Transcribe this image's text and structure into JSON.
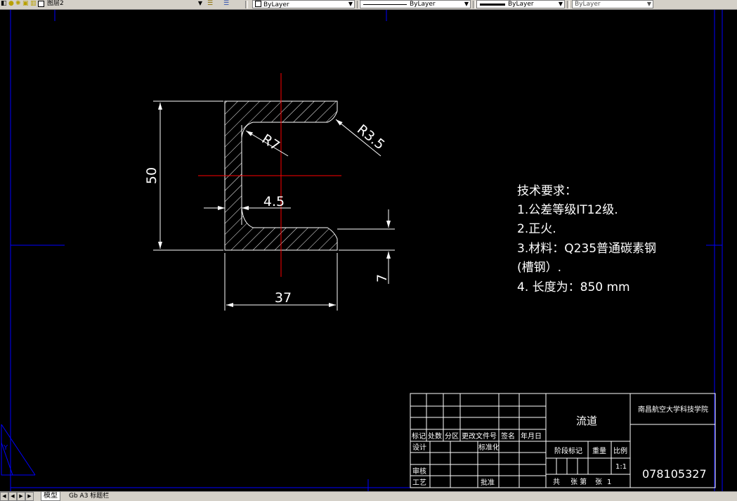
{
  "toolbar": {
    "layer_name": "图层2",
    "color": "ByLayer",
    "linetype": "ByLayer",
    "lineweight": "ByLayer",
    "plotstyle": "ByLayer"
  },
  "drawing": {
    "dim_height": "50",
    "dim_width": "37",
    "dim_web": "4.5",
    "dim_flange": "7",
    "dim_r_inner": "R7",
    "dim_r_outer": "R3.5",
    "notes": [
      "技术要求：",
      "1.公差等级IT12级.",
      "2.正火.",
      "3.材料：Q235普通碳素钢",
      "(槽钢）.",
      "4. 长度为：850 mm"
    ]
  },
  "title_block": {
    "part_name": "流道",
    "school": "南昌航空大学科技学院",
    "drawing_number": "078105327",
    "header_cols": [
      "标记",
      "处数",
      "分区",
      "更改文件号",
      "签名",
      "年月日"
    ],
    "design": "设计",
    "standardize": "标准化",
    "review": "审核",
    "process": "工艺",
    "approve": "批准",
    "stage_mark": "阶段标记",
    "weight": "重量",
    "scale_label": "比例",
    "scale_value": "1:1",
    "sheets": "共",
    "sheets_unit": "张 第",
    "sheet_no": "张",
    "sheet_index": "1"
  },
  "status": {
    "tab_model": "模型",
    "tab_layout": "Gb A3 标题栏"
  },
  "colors": {
    "background": "#000000",
    "geometry": "#ffffff",
    "centerline": "#ff0000",
    "border": "#0000ff"
  }
}
